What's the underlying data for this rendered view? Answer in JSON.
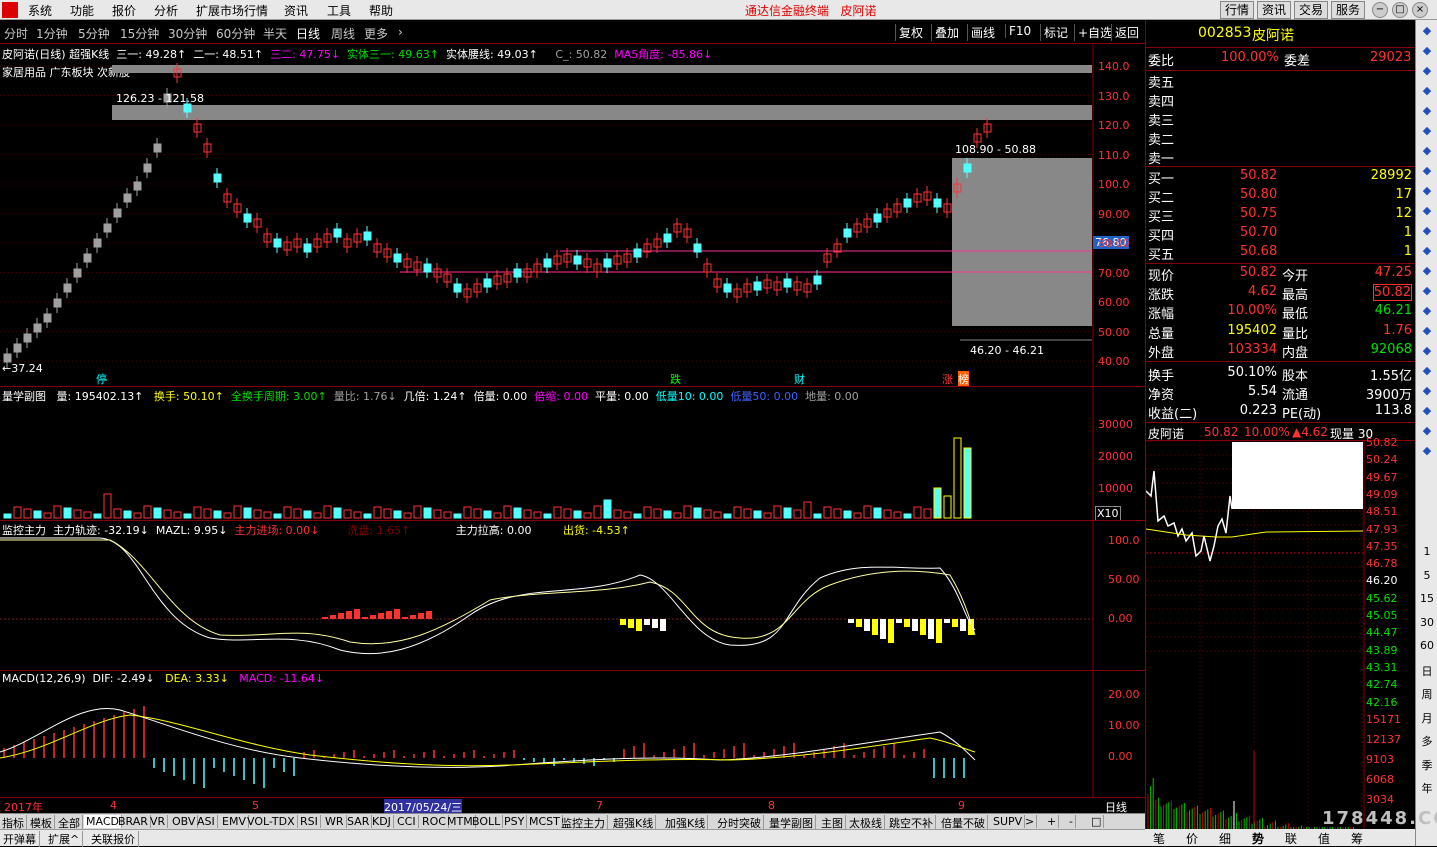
{
  "menubar": {
    "items": [
      "系统",
      "功能",
      "报价",
      "分析",
      "扩展市场行情",
      "资讯",
      "工具",
      "帮助"
    ],
    "center_title": "通达信金融终端",
    "center_stock": "皮阿诺",
    "right_buttons": [
      "行情",
      "资讯",
      "交易",
      "服务"
    ]
  },
  "periods": [
    "分时",
    "1分钟",
    "5分钟",
    "15分钟",
    "30分钟",
    "60分钟",
    "半天",
    "日线",
    "周线",
    "更多",
    "›"
  ],
  "active_period": "日线",
  "toolbar": [
    "复权",
    "叠加",
    "画线",
    "F10",
    "标记",
    "+自选",
    "返回"
  ],
  "main_info": {
    "title": "皮阿诺(日线) 超强K线",
    "l1": "三一: 49.28↑",
    "l2": "二一: 48.51↑",
    "l3": "三二: 47.75↓",
    "l4": "实体三一: 49.63↑",
    "l5": "实体腰线: 49.03↑",
    "l6": "C_: 50.82",
    "l7": "MA5角度: -85.86↓",
    "sector": "家居用品 广东板块 次新股",
    "ann1": "126.23 - 121.58",
    "ann2": "108.90 - 50.88",
    "ann3": "←37.24",
    "ann4": "46.20 - 46.21",
    "price_tag": "76.80",
    "marks": [
      "停",
      "跌",
      "财",
      "涨",
      "榜"
    ]
  },
  "price_axis": [
    "140.0",
    "130.0",
    "120.0",
    "110.0",
    "100.0",
    "90.00",
    "80.00",
    "70.00",
    "60.00",
    "50.00",
    "40.00"
  ],
  "vol_info": {
    "a": "量学副图",
    "b": "量: 195402.13↑",
    "c": "换手: 50.10↑",
    "d": "全换手周期: 3.00↑",
    "e": "量比: 1.76↓",
    "f": "几倍: 1.24↑",
    "g": "倍量: 0.00",
    "h": "倍缩: 0.00",
    "i": "平量: 0.00",
    "j": "低量10: 0.00",
    "k": "低量50: 0.00",
    "l": "地量: 0.00",
    "unit": "X10"
  },
  "vol_axis": [
    "30000",
    "20000",
    "10000"
  ],
  "mon_info": {
    "a": "监控主力",
    "b": "主力轨迹: -32.19↓",
    "c": "MAZL: 9.95↓",
    "d": "主力进场: 0.00↓",
    "e": "洗盘: 1.65↑",
    "f": "主力拉高: 0.00",
    "g": "出货: -4.53↑"
  },
  "mon_axis": [
    "100.0",
    "50.00",
    "0.00"
  ],
  "macd_info": {
    "a": "MACD(12,26,9)",
    "b": "DIF: -2.49↓",
    "c": "DEA: 3.33↓",
    "d": "MACD: -11.64↓"
  },
  "macd_axis": [
    "20.00",
    "10.00",
    "0.00"
  ],
  "dates": [
    "2017年",
    "4",
    "5",
    "2017/05/24/三",
    "7",
    "8",
    "9"
  ],
  "date_right": "日线",
  "bottom_tabs": [
    "指标",
    "模板",
    "全部",
    "MACD",
    "BRAR",
    "VR",
    "OBV",
    "ASI",
    "EMV",
    "VOL-TDX",
    "RSI",
    "WR",
    "SAR",
    "KDJ",
    "CCI",
    "ROC",
    "MTM",
    "BOLL",
    "PSY",
    "MCST",
    "监控主力",
    "超强K线",
    "加强K线",
    "分时突破",
    "量学副图",
    "主图",
    "太极线",
    "跳空不补",
    "倍量不破",
    "SUPV",
    ">",
    "+",
    "-",
    "□"
  ],
  "status": [
    "开弹幕",
    "扩展^",
    "关联报价"
  ],
  "quote": {
    "code": "002853",
    "name": "皮阿诺",
    "webi_label": "委比",
    "webi": "100.00%",
    "wecha_label": "委差",
    "wecha": "29023",
    "sells": [
      "卖五",
      "卖四",
      "卖三",
      "卖二",
      "卖一"
    ],
    "buys": [
      {
        "l": "买一",
        "p": "50.82",
        "v": "28992"
      },
      {
        "l": "买二",
        "p": "50.80",
        "v": "17"
      },
      {
        "l": "买三",
        "p": "50.75",
        "v": "12"
      },
      {
        "l": "买四",
        "p": "50.70",
        "v": "1"
      },
      {
        "l": "买五",
        "p": "50.68",
        "v": "1"
      }
    ],
    "stats": [
      {
        "l1": "现价",
        "v1": "50.82",
        "l2": "今开",
        "v2": "47.25"
      },
      {
        "l1": "涨跌",
        "v1": "4.62",
        "l2": "最高",
        "v2": "50.82"
      },
      {
        "l1": "涨幅",
        "v1": "10.00%",
        "l2": "最低",
        "v2": "46.21"
      },
      {
        "l1": "总量",
        "v1": "195402",
        "l2": "量比",
        "v2": "1.76"
      },
      {
        "l1": "外盘",
        "v1": "103334",
        "l2": "内盘",
        "v2": "92068"
      },
      {
        "l1": "换手",
        "v1": "50.10%",
        "l2": "股本",
        "v2": "1.55亿"
      },
      {
        "l1": "净资",
        "v1": "5.54",
        "l2": "流通",
        "v2": "3900万"
      },
      {
        "l1": "收益(二)",
        "v1": "0.223",
        "l2": "PE(动)",
        "v2": "113.8"
      }
    ],
    "mini_title": "皮阿诺",
    "mini_price": "50.82",
    "mini_pct": "10.00%",
    "mini_chg": "▲4.62",
    "mini_vol": "现量 30",
    "mini_axis": [
      "50.82",
      "50.24",
      "49.67",
      "49.09",
      "48.51",
      "47.93",
      "47.35",
      "46.78",
      "46.20",
      "45.62",
      "45.05",
      "44.47",
      "43.89",
      "43.31",
      "42.74",
      "42.16"
    ],
    "mini_vol_axis": [
      "15171",
      "12137",
      "9103",
      "6068",
      "3034"
    ],
    "mini_tabs": [
      "笔",
      "价",
      "细",
      "势",
      "联",
      "值",
      "筹"
    ]
  },
  "sidebar": [
    "1",
    "5",
    "15",
    "30",
    "60",
    "日",
    "周",
    "月",
    "多",
    "季",
    "年"
  ],
  "watermark": "178448.COM"
}
